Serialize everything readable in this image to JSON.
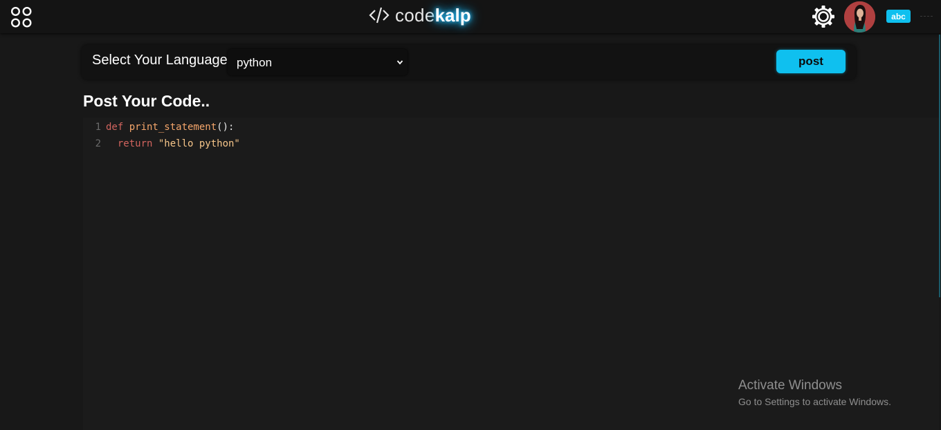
{
  "header": {
    "logo_prefix": "code",
    "logo_suffix": "kalp",
    "logo_icon": "code-brackets-icon",
    "username_badge": "abc",
    "icons": [
      "apps-icon",
      "gear-icon"
    ],
    "accent_color": "#0fc0ef"
  },
  "toolbar": {
    "language_label": "Select Your Language",
    "language_selected": "python",
    "post_label": "post"
  },
  "main": {
    "title": "Post Your Code.."
  },
  "editor": {
    "lines": [
      {
        "number": "1",
        "tokens": [
          {
            "text": "def ",
            "kind": "kw"
          },
          {
            "text": "print_statement",
            "kind": "fn"
          },
          {
            "text": "():",
            "kind": "punc"
          }
        ]
      },
      {
        "number": "2",
        "tokens": [
          {
            "text": "  return ",
            "kind": "kw"
          },
          {
            "text": "\"hello python\"",
            "kind": "str"
          }
        ]
      }
    ]
  },
  "watermark": {
    "title": "Activate Windows",
    "subtitle": "Go to Settings to activate Windows."
  }
}
